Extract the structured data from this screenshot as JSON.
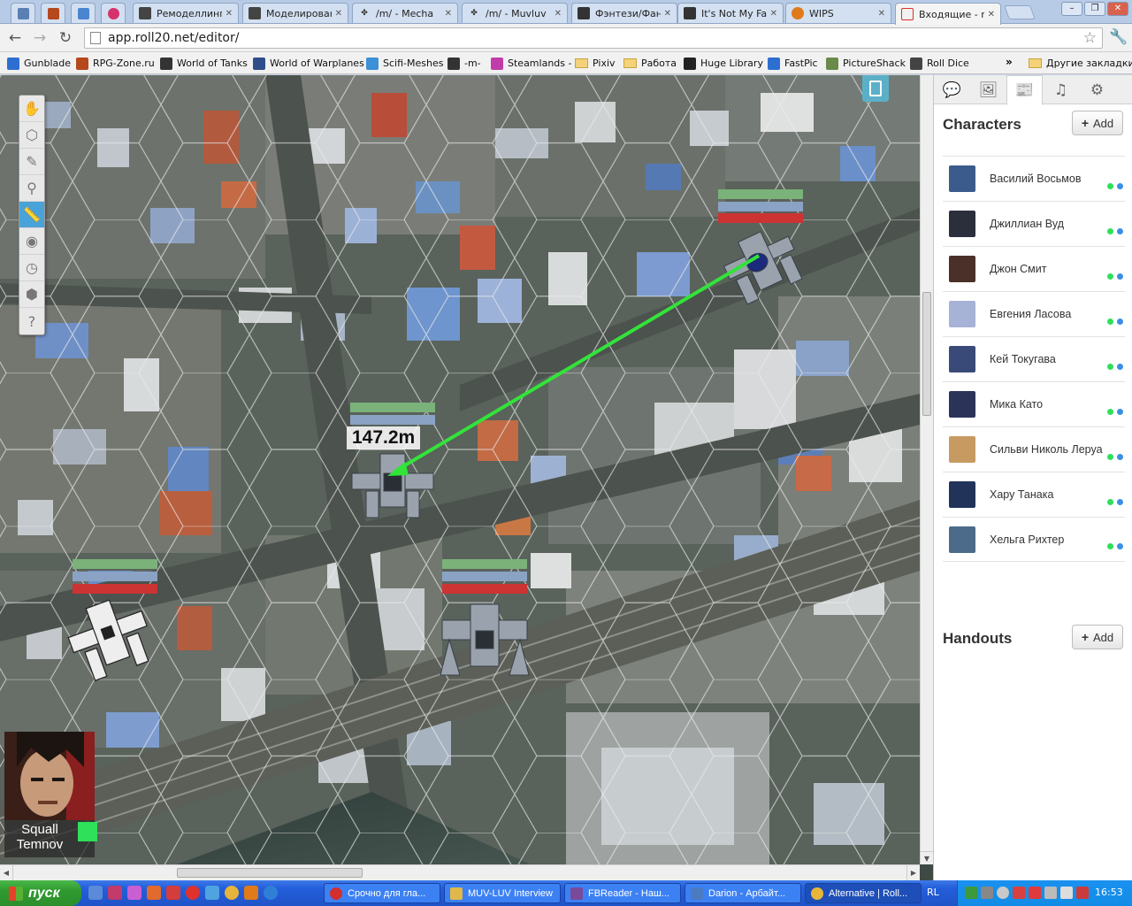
{
  "browser": {
    "tabs": [
      {
        "label": "",
        "icon_color": "#5a7fb5",
        "icon": "grid-icon"
      },
      {
        "label": "",
        "icon_color": "#c0392b",
        "icon": "r-icon"
      },
      {
        "label": "",
        "icon_color": "#4a86d0",
        "icon": "v-icon"
      },
      {
        "label": "",
        "icon_color": "#d6336c",
        "icon": "roll20-icon"
      },
      {
        "label": "Ремоделлинг",
        "icon_color": "#444",
        "icon": "shield-icon"
      },
      {
        "label": "Моделирован",
        "icon_color": "#444",
        "icon": "shield-icon"
      },
      {
        "label": "/m/ - Mecha",
        "icon_color": "#333",
        "icon": "clover-icon"
      },
      {
        "label": "/m/ - Muvluv",
        "icon_color": "#333",
        "icon": "clover-icon"
      },
      {
        "label": "Фэнтези/Фант",
        "icon_color": "#333",
        "icon": "page-icon"
      },
      {
        "label": "It's Not My Fau",
        "icon_color": "#333",
        "icon": "page-icon"
      },
      {
        "label": "WIPS",
        "icon_color": "#e07a1a",
        "icon": "wips-icon"
      },
      {
        "label": "Входящие - ni",
        "icon_color": "#d93025",
        "icon": "gmail-icon"
      }
    ],
    "url": "app.roll20.net/editor/",
    "bookmarks": [
      {
        "label": "Gunblade",
        "icon_color": "#2d6fd1"
      },
      {
        "label": "RPG-Zone.ru",
        "icon_color": "#b5481c"
      },
      {
        "label": "World of Tanks",
        "icon_color": "#333"
      },
      {
        "label": "World of Warplanes",
        "icon_color": "#2e4d8a"
      },
      {
        "label": "Scifi-Meshes",
        "icon_color": "#3d8fd6"
      },
      {
        "label": "-m-",
        "icon_color": "#333"
      },
      {
        "label": "Steamlands -",
        "icon_color": "#c13ca8"
      },
      {
        "label": "Pixiv",
        "icon_color": "folder"
      },
      {
        "label": "Работа",
        "icon_color": "folder"
      },
      {
        "label": "Huge Library",
        "icon_color": "#222"
      },
      {
        "label": "FastPic",
        "icon_color": "#2d6fd1"
      },
      {
        "label": "PictureShack",
        "icon_color": "#6a8a4a"
      },
      {
        "label": "Roll Dice",
        "icon_color": "#444"
      }
    ],
    "other_bookmarks": "Другие закладки",
    "more": "»"
  },
  "map": {
    "distance_label": "147.2m"
  },
  "player": {
    "name": "Squall Temnov",
    "color": "#2ee05a"
  },
  "sidebar": {
    "characters_title": "Characters",
    "add_label": "Add",
    "handouts_title": "Handouts",
    "characters": [
      {
        "name": "Василий Восьмов",
        "avatar_color": "#3b5b8c"
      },
      {
        "name": "Джиллиан Вуд",
        "avatar_color": "#2b2f3c"
      },
      {
        "name": "Джон Смит",
        "avatar_color": "#4a3028"
      },
      {
        "name": "Евгения Ласова",
        "avatar_color": "#a6b2d6"
      },
      {
        "name": "Кей Токугава",
        "avatar_color": "#3a4a78"
      },
      {
        "name": "Мика Като",
        "avatar_color": "#2c3358"
      },
      {
        "name": "Сильви Николь Леруа",
        "avatar_color": "#c79a62"
      },
      {
        "name": "Хару Танака",
        "avatar_color": "#22335a"
      },
      {
        "name": "Хельга Рихтер",
        "avatar_color": "#4c6a8a"
      }
    ]
  },
  "taskbar": {
    "start": "пуск",
    "tasks": [
      {
        "label": "Срочно для гла...",
        "icon_color": "#d32f2f"
      },
      {
        "label": "MUV-LUV Interview",
        "icon_color": "#e0b84a"
      },
      {
        "label": "FBReader - Наш...",
        "icon_color": "#7a4a9a"
      },
      {
        "label": "Darion - Арбайт...",
        "icon_color": "#4a7ac0"
      },
      {
        "label": "Alternative | Roll...",
        "icon_color": "#e8b63a"
      }
    ],
    "lang": "RL",
    "clock": "16:53"
  }
}
